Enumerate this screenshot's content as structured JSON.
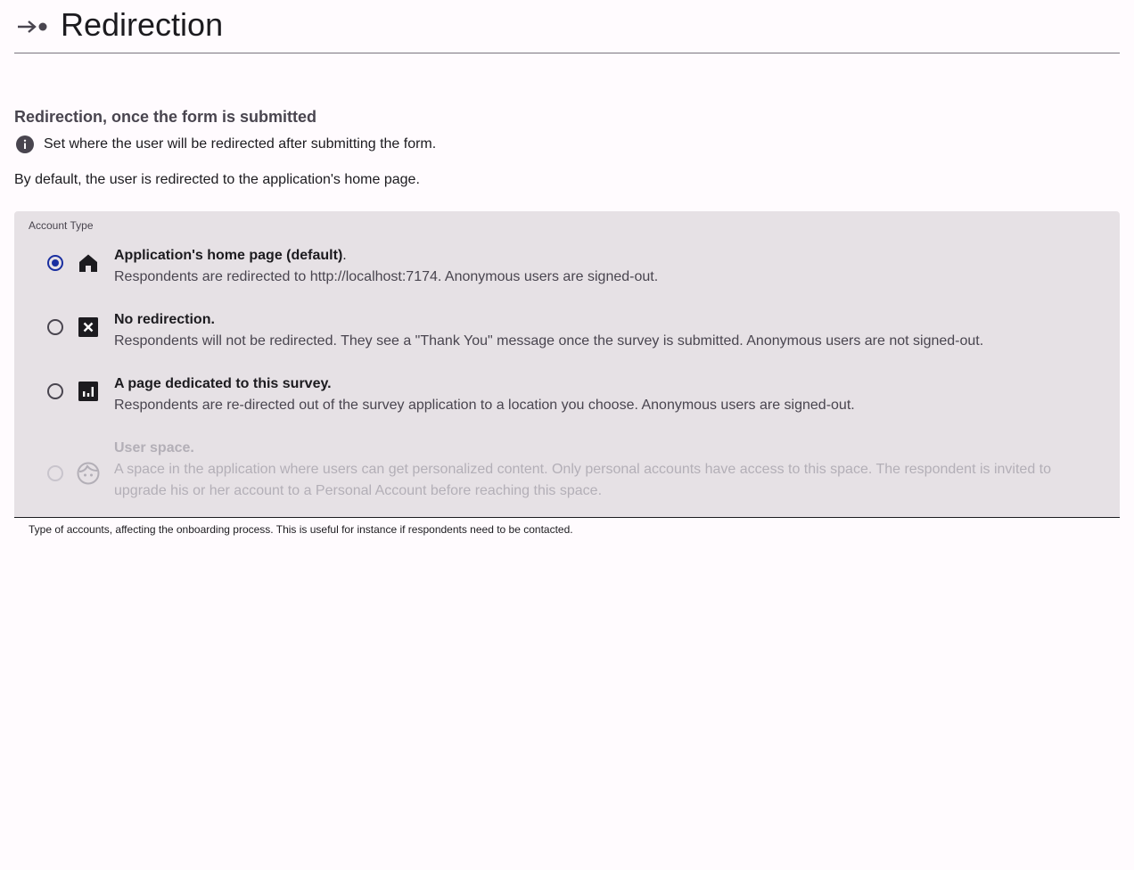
{
  "header": {
    "title": "Redirection",
    "icon": "arrow-right-dot-icon"
  },
  "section": {
    "title": "Redirection, once the form is submitted",
    "info_text": "Set where the user will be redirected after submitting the form.",
    "default_text": "By default, the user is redirected to the application's home page."
  },
  "radio_group": {
    "label": "Account Type",
    "helper_text": "Type of accounts, affecting the onboarding process. This is useful for instance if respondents need to be contacted.",
    "selected_color": "#1a2fa0",
    "options": [
      {
        "title": "Application's home page (default)",
        "title_suffix": ".",
        "description": "Respondents are redirected to http://localhost:7174. Anonymous users are signed-out.",
        "icon": "home-icon",
        "selected": true,
        "disabled": false
      },
      {
        "title": "No redirection.",
        "title_suffix": "",
        "description": "Respondents will not be redirected. They see a \"Thank You\" message once the survey is submitted. Anonymous users are not signed-out.",
        "icon": "close-box-icon",
        "selected": false,
        "disabled": false
      },
      {
        "title": "A page dedicated to this survey.",
        "title_suffix": "",
        "description": "Respondents are re-directed out of the survey application to a location you choose. Anonymous users are signed-out.",
        "icon": "chart-box-icon",
        "selected": false,
        "disabled": false
      },
      {
        "title": "User space.",
        "title_suffix": "",
        "description": "A space in the application where users can get personalized content. Only personal accounts have access to this space. The respondent is invited to upgrade his or her account to a Personal Account before reaching this space.",
        "icon": "face-icon",
        "selected": false,
        "disabled": true
      }
    ]
  }
}
